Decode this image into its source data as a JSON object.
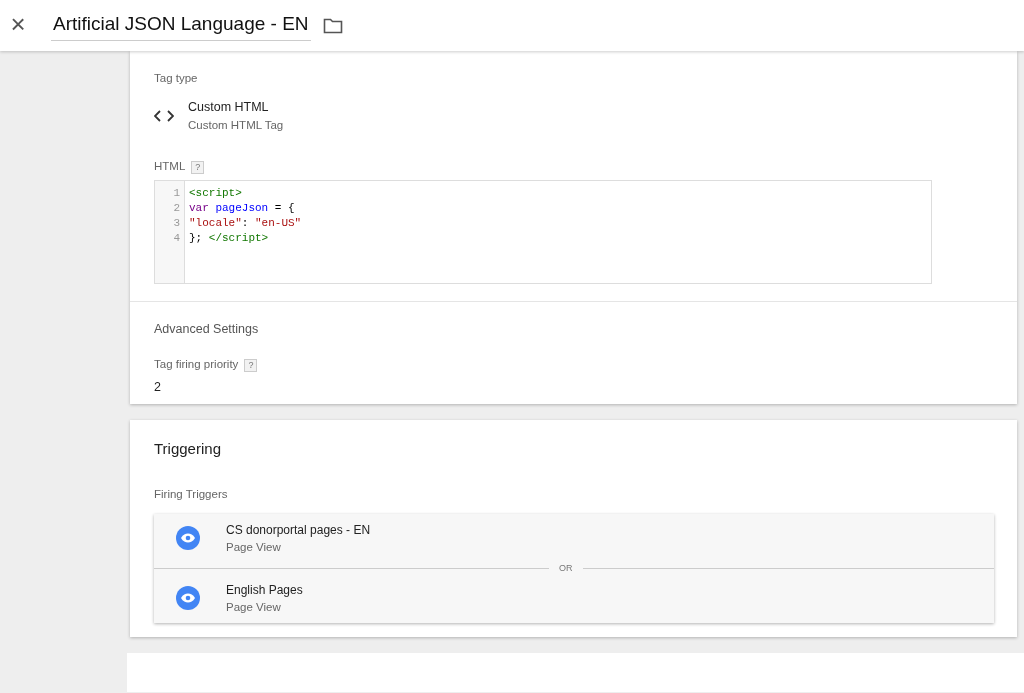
{
  "header": {
    "close": "×",
    "title": "Artificial JSON Language - EN"
  },
  "tag_config": {
    "tag_type_label": "Tag type",
    "tag_type": {
      "name": "Custom HTML",
      "description": "Custom HTML Tag"
    },
    "html_label": "HTML",
    "help": "?",
    "code_lines": [
      {
        "number": "1",
        "tokens": [
          {
            "text": "<script>",
            "kind": "tag"
          }
        ]
      },
      {
        "number": "2",
        "tokens": [
          {
            "text": "var",
            "kind": "keyword"
          },
          {
            "text": " pageJson",
            "kind": "variable"
          },
          {
            "text": " = {",
            "kind": "plain"
          }
        ]
      },
      {
        "number": "3",
        "tokens": [
          {
            "text": "\"locale\"",
            "kind": "string"
          },
          {
            "text": ": ",
            "kind": "plain"
          },
          {
            "text": "\"en-US\"",
            "kind": "string"
          }
        ]
      },
      {
        "number": "4",
        "tokens": [
          {
            "text": "}; ",
            "kind": "plain"
          },
          {
            "text": "</script>",
            "kind": "tag"
          }
        ]
      }
    ],
    "advanced_title": "Advanced Settings",
    "priority_label": "Tag firing priority",
    "priority_help": "?",
    "priority_value": "2"
  },
  "triggering": {
    "title": "Triggering",
    "firing_label": "Firing Triggers",
    "separator": "OR",
    "triggers": [
      {
        "name": "CS donorportal pages - EN",
        "type": "Page View"
      },
      {
        "name": "English Pages",
        "type": "Page View"
      }
    ]
  }
}
